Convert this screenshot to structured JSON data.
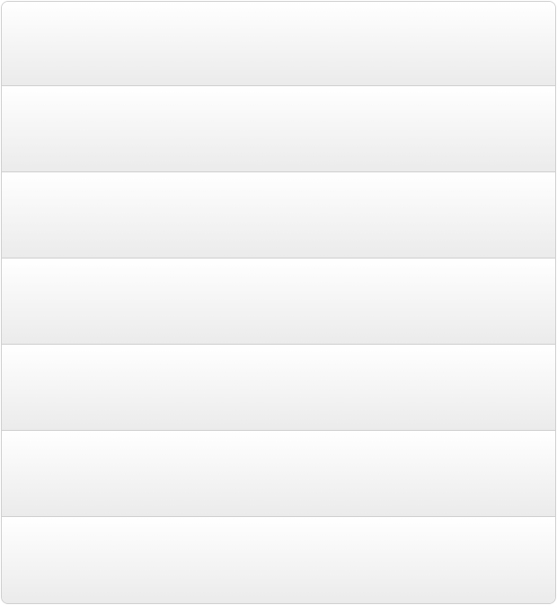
{
  "list": {
    "rows": [
      {
        "label": ""
      },
      {
        "label": ""
      },
      {
        "label": ""
      },
      {
        "label": ""
      },
      {
        "label": ""
      },
      {
        "label": ""
      },
      {
        "label": ""
      }
    ]
  }
}
